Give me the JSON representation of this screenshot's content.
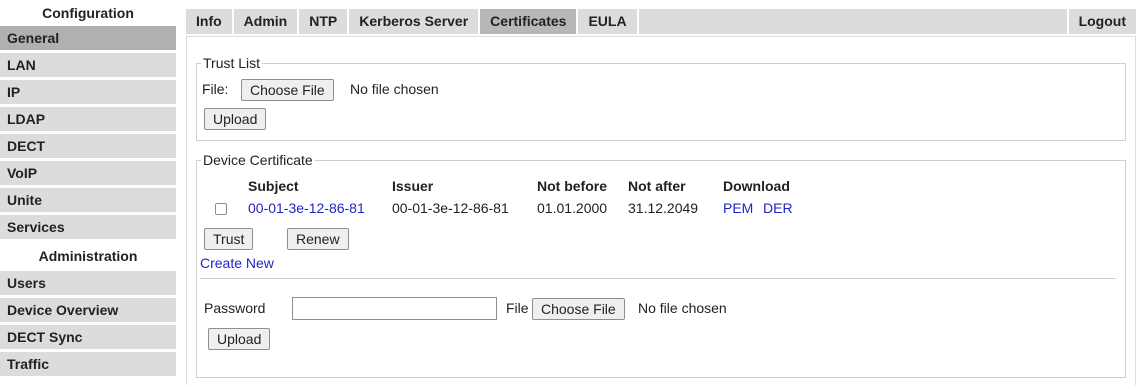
{
  "sidebar": {
    "config_header": "Configuration",
    "config_items": [
      "General",
      "LAN",
      "IP",
      "LDAP",
      "DECT",
      "VoIP",
      "Unite",
      "Services"
    ],
    "admin_header": "Administration",
    "admin_items": [
      "Users",
      "Device Overview",
      "DECT Sync",
      "Traffic"
    ]
  },
  "nav": {
    "tabs": [
      "Info",
      "Admin",
      "NTP",
      "Kerberos Server",
      "Certificates",
      "EULA"
    ],
    "active_tab": "Certificates",
    "logout": "Logout"
  },
  "trust_list": {
    "legend": "Trust List",
    "file_label": "File:",
    "choose_file": "Choose File",
    "no_file": "No file chosen",
    "upload": "Upload"
  },
  "device_cert": {
    "legend": "Device Certificate",
    "columns": [
      "Subject",
      "Issuer",
      "Not before",
      "Not after",
      "Download"
    ],
    "row": {
      "subject": "00-01-3e-12-86-81",
      "issuer": "00-01-3e-12-86-81",
      "not_before": "01.01.2000",
      "not_after": "31.12.2049",
      "pem": "PEM",
      "der": "DER"
    },
    "trust": "Trust",
    "renew": "Renew",
    "create_new": "Create New",
    "password_label": "Password",
    "file_label": "File",
    "choose_file": "Choose File",
    "no_file": "No file chosen",
    "upload": "Upload"
  },
  "colors": {
    "link": "#2323c7",
    "nav_bg": "#dcdcdc",
    "active_bg": "#b7b7b7"
  }
}
